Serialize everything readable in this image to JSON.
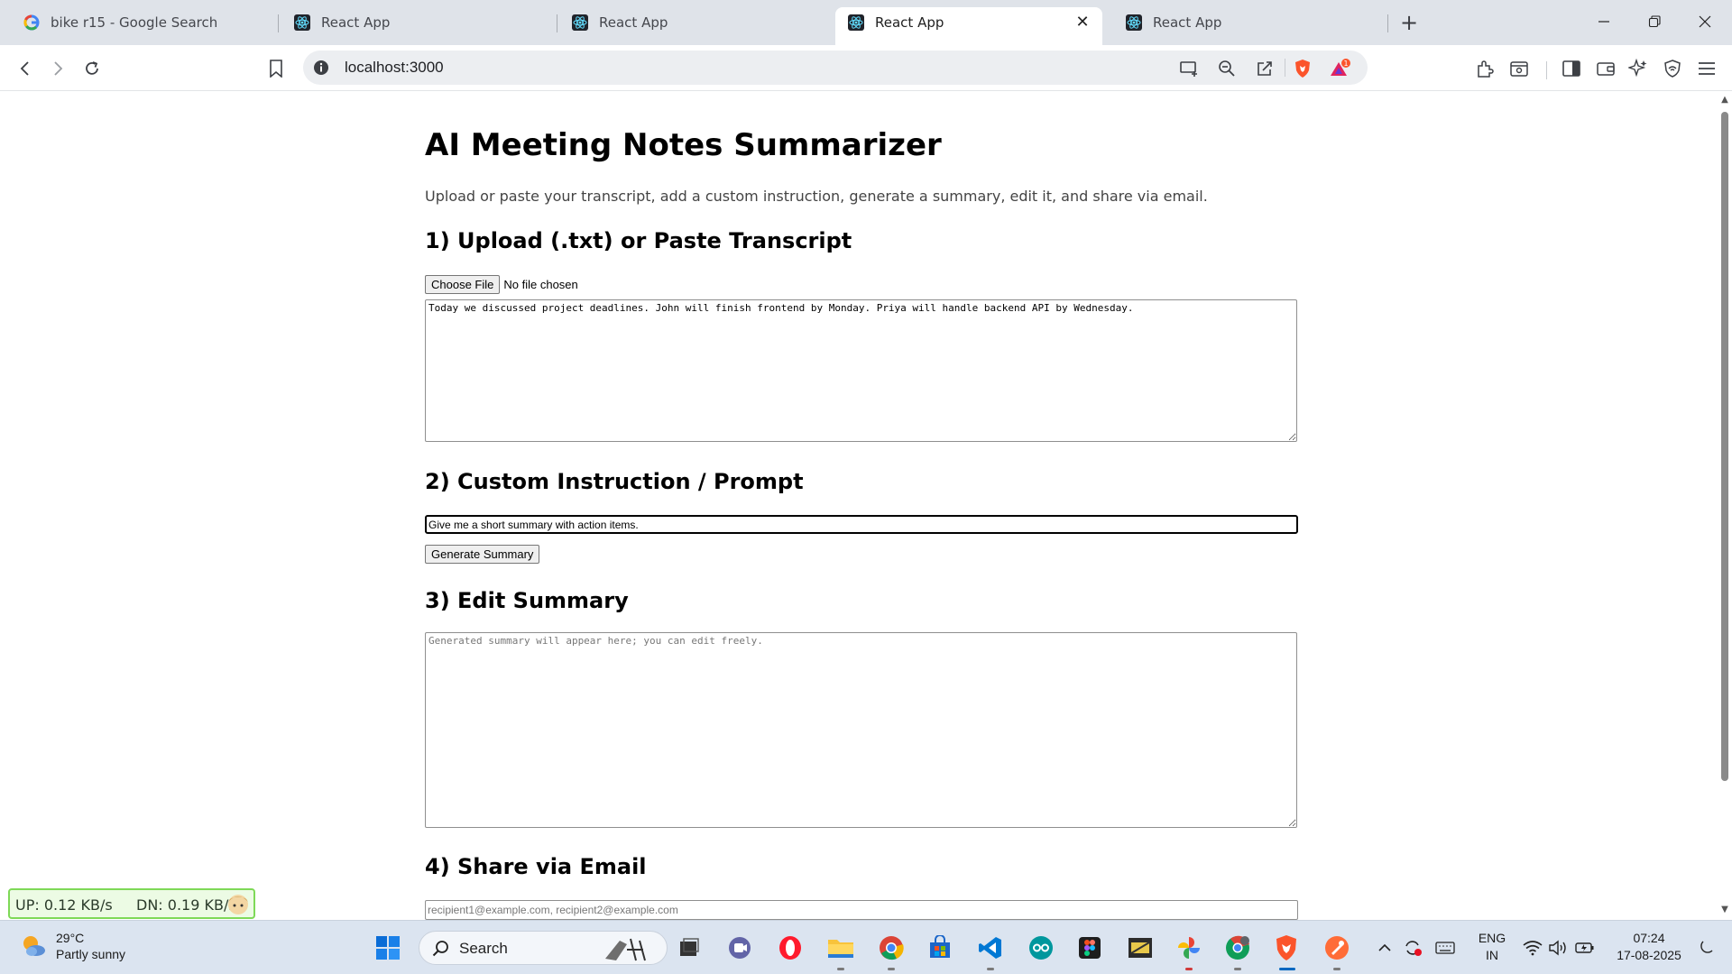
{
  "browser": {
    "tabs": [
      {
        "title": "bike r15 - Google Search",
        "favicon": "google-g-icon",
        "active": false
      },
      {
        "title": "React App",
        "favicon": "react-icon",
        "active": false
      },
      {
        "title": "React App",
        "favicon": "react-icon",
        "active": false
      },
      {
        "title": "React App",
        "favicon": "react-icon",
        "active": true
      },
      {
        "title": "React App",
        "favicon": "react-icon",
        "active": false
      }
    ],
    "new_tab": "+",
    "close_tab": "✕",
    "url": "localhost:3000",
    "rewards_badge": "1",
    "accent_brave": "#fb542b"
  },
  "page": {
    "title": "AI Meeting Notes Summarizer",
    "subtitle": "Upload or paste your transcript, add a custom instruction, generate a summary, edit it, and share via email.",
    "section1": {
      "heading": "1) Upload (.txt) or Paste Transcript",
      "choose_file": "Choose File",
      "file_status": "No file chosen",
      "transcript": "Today we discussed project deadlines. John will finish frontend by Monday. Priya will handle backend API by Wednesday."
    },
    "section2": {
      "heading": "2) Custom Instruction / Prompt",
      "prompt_value": "Give me a short summary with action items.",
      "generate_button": "Generate Summary"
    },
    "section3": {
      "heading": "3) Edit Summary",
      "summary_placeholder": "Generated summary will appear here; you can edit freely."
    },
    "section4": {
      "heading": "4) Share via Email",
      "email_placeholder": "recipient1@example.com, recipient2@example.com"
    }
  },
  "netmeter": {
    "up": "UP: 0.12 KB/s",
    "dn": "DN: 0.19 KB/s"
  },
  "taskbar": {
    "weather_temp": "29°C",
    "weather_desc": "Partly sunny",
    "search_label": "Search",
    "lang_line1": "ENG",
    "lang_line2": "IN",
    "time": "07:24",
    "date": "17-08-2025"
  }
}
